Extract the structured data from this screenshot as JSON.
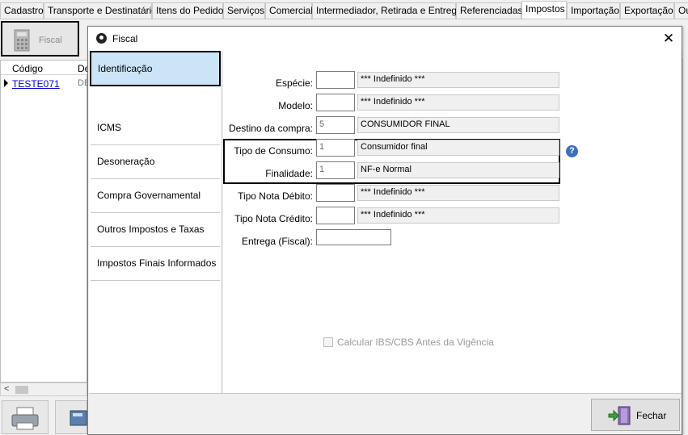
{
  "tabs": [
    {
      "label": "Cadastro",
      "active": false
    },
    {
      "label": "Transporte e Destinatário",
      "active": false
    },
    {
      "label": "Itens do Pedido",
      "active": false
    },
    {
      "label": "Serviços",
      "active": false
    },
    {
      "label": "Comercial",
      "active": false
    },
    {
      "label": "Intermediador, Retirada e Entrega",
      "active": false
    },
    {
      "label": "Referenciadas",
      "active": false
    },
    {
      "label": "Impostos",
      "active": true
    },
    {
      "label": "Importação",
      "active": false
    },
    {
      "label": "Exportação",
      "active": false
    },
    {
      "label": "Ou",
      "active": false
    }
  ],
  "toolbar": {
    "fiscal_label": "Fiscal"
  },
  "grid": {
    "headers": [
      "Código",
      "De"
    ],
    "rows": [
      {
        "code": "TESTE071",
        "desc": "DE"
      }
    ]
  },
  "dialog": {
    "title": "Fiscal",
    "close_glyph": "✕",
    "sidebar": [
      {
        "label": "Identificação",
        "selected": true
      },
      {
        "label": "ICMS",
        "selected": false
      },
      {
        "label": "Desoneração",
        "selected": false
      },
      {
        "label": "Compra Governamental",
        "selected": false
      },
      {
        "label": "Outros Impostos e Taxas",
        "selected": false
      },
      {
        "label": "Impostos Finais Informados",
        "selected": false
      }
    ],
    "fields": [
      {
        "label": "Espécie:",
        "code": "",
        "desc": "*** Indefinido ***"
      },
      {
        "label": "Modelo:",
        "code": "",
        "desc": "*** Indefinido ***"
      },
      {
        "label": "Destino da compra:",
        "code": "5",
        "desc": "CONSUMIDOR FINAL"
      },
      {
        "label": "Tipo de Consumo:",
        "code": "1",
        "desc": "Consumidor final"
      },
      {
        "label": "Finalidade:",
        "code": "1",
        "desc": "NF-e Normal"
      },
      {
        "label": "Tipo Nota Débito:",
        "code": "",
        "desc": "*** Indefinido ***"
      },
      {
        "label": "Tipo Nota Crédito:",
        "code": "",
        "desc": "*** Indefinido ***"
      }
    ],
    "entrega_label": "Entrega (Fiscal):",
    "entrega_value": "",
    "help_glyph": "?",
    "checkbox_label": "Calcular IBS/CBS Antes da Vigência",
    "checkbox_checked": false,
    "fechar_label": "Fechar"
  },
  "colors": {
    "selected_nav": "#cce4f7",
    "link": "#0000cc",
    "help_icon": "#3c6fc0"
  }
}
